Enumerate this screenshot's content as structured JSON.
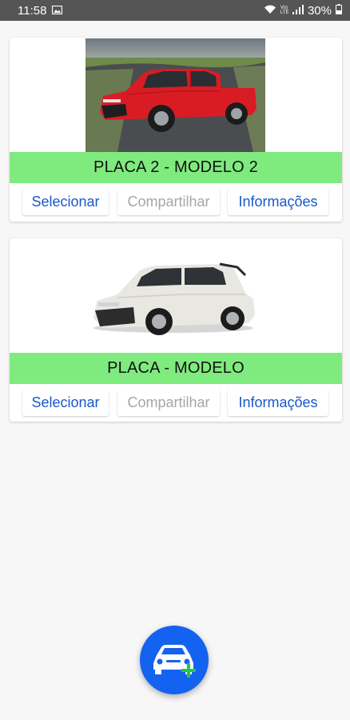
{
  "status_bar": {
    "time": "11:58",
    "signal_labels": "Vo) LTE",
    "battery": "30%",
    "icons": [
      "gallery-icon",
      "wifi-icon",
      "signal-icon",
      "battery-icon"
    ]
  },
  "vehicles": [
    {
      "plate_model": "PLACA 2 - MODELO 2",
      "car_color": "#d91c24",
      "actions": {
        "select": "Selecionar",
        "share": "Compartilhar",
        "info": "Informações"
      }
    },
    {
      "plate_model": "PLACA - MODELO",
      "car_color": "#e9e7e2",
      "actions": {
        "select": "Selecionar",
        "share": "Compartilhar",
        "info": "Informações"
      }
    }
  ],
  "fab": {
    "icon": "add-car-icon",
    "color": "#1463f0"
  },
  "colors": {
    "plate_bar": "#7feb7f",
    "action_text": "#1a58c8",
    "disabled_text": "#a6a6a6",
    "status_bar": "#555555"
  }
}
